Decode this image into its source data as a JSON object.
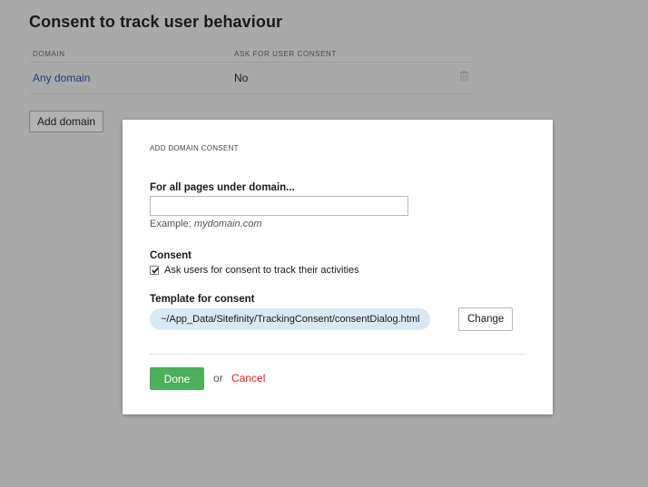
{
  "page": {
    "title": "Consent to track user behaviour"
  },
  "table": {
    "headers": {
      "domain": "DOMAIN",
      "ask_consent": "ASK FOR USER CONSENT"
    },
    "rows": [
      {
        "domain": "Any domain",
        "ask_consent": "No",
        "delete_icon": "trash-icon"
      }
    ]
  },
  "add_domain_button": "Add domain",
  "dialog": {
    "title": "ADD DOMAIN CONSENT",
    "domain_label": "For all pages under domain...",
    "domain_value": "",
    "example_prefix": "Example:",
    "example_value": "mydomain.com",
    "consent_label": "Consent",
    "consent_checkbox_label": "Ask users for consent to track their activities",
    "consent_checked": true,
    "template_label": "Template for consent",
    "template_path": "~/App_Data/Sitefinity/TrackingConsent/consentDialog.html",
    "change_button": "Change",
    "done_button": "Done",
    "or_text": "or",
    "cancel_link": "Cancel"
  },
  "colors": {
    "overlay_background": "#a9a9a9",
    "link": "#1f3f7a",
    "done_green": "#4caf5a",
    "cancel_red": "#e0231b",
    "template_pill": "#d8e9f5"
  }
}
